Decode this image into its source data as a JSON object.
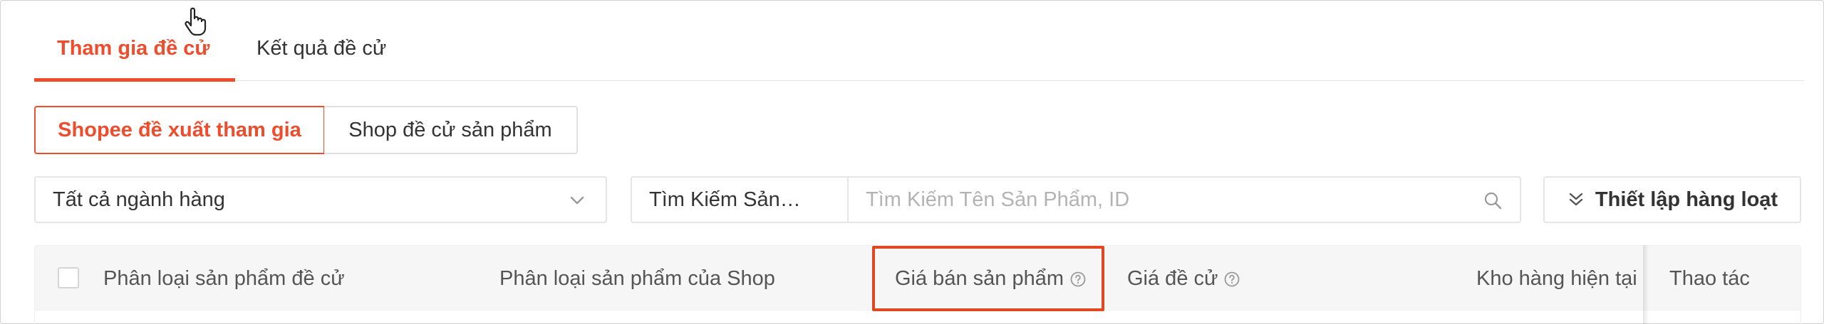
{
  "tabs": [
    {
      "label": "Tham gia đề cử",
      "active": true
    },
    {
      "label": "Kết quả đề cử",
      "active": false
    }
  ],
  "segments": [
    {
      "label": "Shopee đề xuất tham gia",
      "active": true
    },
    {
      "label": "Shop đề cử sản phẩm",
      "active": false
    }
  ],
  "filters": {
    "category_select": "Tất cả ngành hàng",
    "search_type": "Tìm Kiếm Sản…",
    "search_placeholder": "Tìm Kiếm Tên Sản Phẩm, ID",
    "bulk_button": "Thiết lập hàng loạt"
  },
  "table": {
    "headers": [
      "Phân loại sản phẩm đề cử",
      "Phân loại sản phẩm của Shop",
      "Giá bán sản phẩm",
      "Giá đề cử",
      "Kho hàng hiện tại",
      "Thao tác"
    ]
  },
  "colors": {
    "accent": "#ee4d2d",
    "highlight_box": "#e0491f"
  },
  "icons": [
    "chevron-down-icon",
    "search-icon",
    "double-chevron-down-icon",
    "help-circle-icon",
    "hand-pointer-icon"
  ]
}
